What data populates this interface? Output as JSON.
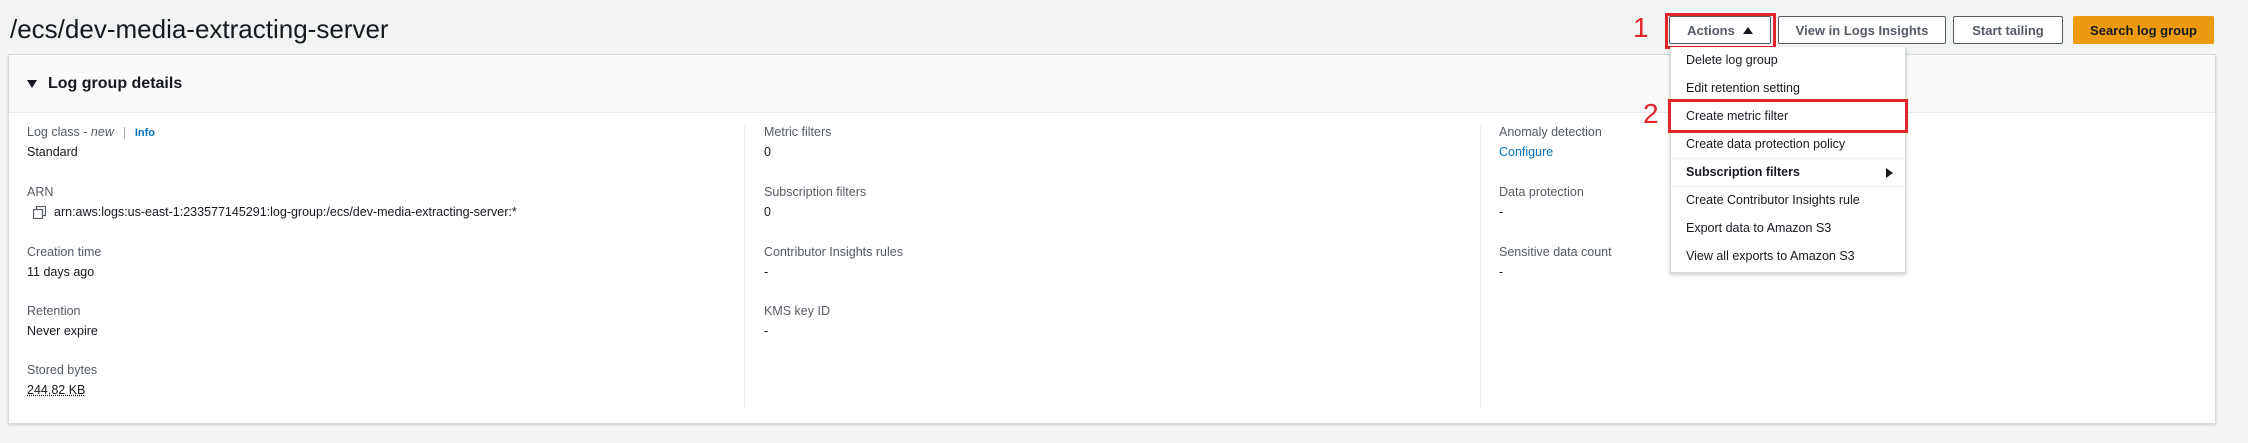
{
  "page_title": "/ecs/dev-media-extracting-server",
  "header_buttons": {
    "actions": "Actions",
    "view_insights": "View in Logs Insights",
    "start_tailing": "Start tailing",
    "search_log_group": "Search log group"
  },
  "annotations": {
    "one": "1",
    "two": "2"
  },
  "panel": {
    "title": "Log group details"
  },
  "col1": {
    "log_class_label": "Log class - ",
    "log_class_new": "new",
    "info": "Info",
    "log_class_value": "Standard",
    "arn_label": "ARN",
    "arn_value": "arn:aws:logs:us-east-1:233577145291:log-group:/ecs/dev-media-extracting-server:*",
    "creation_label": "Creation time",
    "creation_value": "11 days ago",
    "retention_label": "Retention",
    "retention_value": "Never expire",
    "stored_label": "Stored bytes",
    "stored_value": "244.82 KB"
  },
  "col2": {
    "metric_label": "Metric filters",
    "metric_value": "0",
    "subscription_label": "Subscription filters",
    "subscription_value": "0",
    "contributor_label": "Contributor Insights rules",
    "contributor_value": "-",
    "kms_label": "KMS key ID",
    "kms_value": "-"
  },
  "col3": {
    "anomaly_label": "Anomaly detection",
    "anomaly_value": "Configure",
    "protection_label": "Data protection",
    "protection_value": "-",
    "sensitive_label": "Sensitive data count",
    "sensitive_value": "-"
  },
  "dropdown": {
    "items": [
      "Delete log group",
      "Edit retention setting",
      "Create metric filter",
      "Create data protection policy",
      "Subscription filters",
      "Create Contributor Insights rule",
      "Export data to Amazon S3",
      "View all exports to Amazon S3"
    ]
  },
  "colors": {
    "primary": "#ec9b0f",
    "link": "#0073bb",
    "annotation": "#e0252b"
  }
}
